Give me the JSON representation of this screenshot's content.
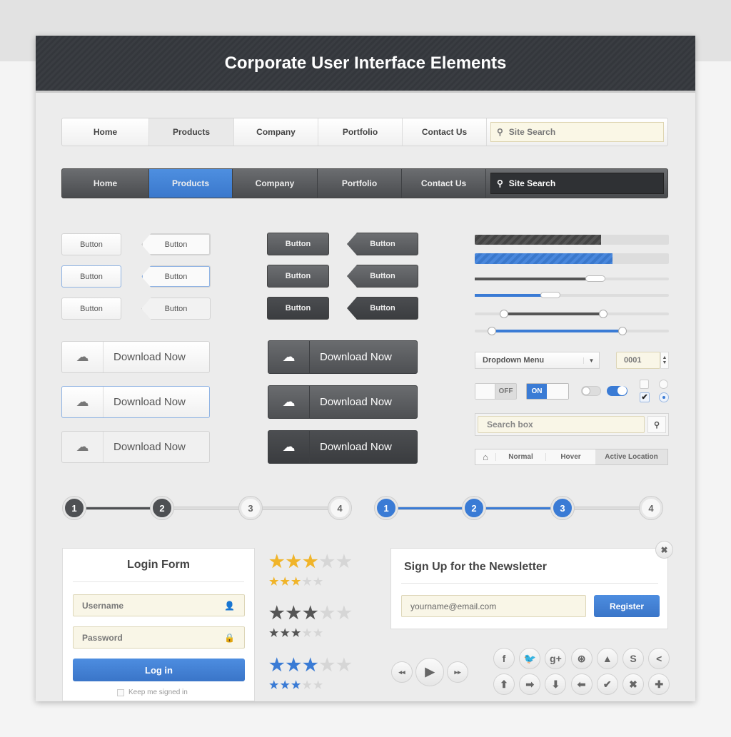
{
  "header": {
    "title": "Corporate User Interface Elements"
  },
  "nav_light": {
    "items": [
      "Home",
      "Products",
      "Company",
      "Portfolio",
      "Contact Us"
    ],
    "active": 1,
    "search_placeholder": "Site Search"
  },
  "nav_dark": {
    "items": [
      "Home",
      "Products",
      "Company",
      "Portfolio",
      "Contact Us"
    ],
    "active": 1,
    "search_placeholder": "Site Search"
  },
  "buttons": {
    "label": "Button"
  },
  "download": {
    "label": "Download Now",
    "icon": "cloud-download-icon"
  },
  "progress": {
    "bar1": 0.65,
    "bar2": 0.71
  },
  "sliders": {
    "s1": 0.62,
    "s2": 0.39,
    "range1": [
      0.15,
      0.66
    ],
    "range2": [
      0.09,
      0.76
    ]
  },
  "dropdown": {
    "value": "Dropdown Menu"
  },
  "number": {
    "value": "0001"
  },
  "toggles": {
    "off": "OFF",
    "on": "ON"
  },
  "search_box": {
    "value": "Search box"
  },
  "breadcrumb": {
    "items": [
      "Normal",
      "Hover",
      "Active Location"
    ]
  },
  "steppers": {
    "steps": [
      "1",
      "2",
      "3",
      "4"
    ],
    "dark_active": 2,
    "blue_active": 3
  },
  "login": {
    "title": "Login Form",
    "username": "Username",
    "password": "Password",
    "submit": "Log in",
    "remember": "Keep me signed in"
  },
  "ratings": [
    {
      "value": 3,
      "max": 5,
      "color": "#f0b429"
    },
    {
      "value": 3,
      "max": 5,
      "color": "#555555"
    },
    {
      "value": 3,
      "max": 5,
      "color": "#3a7bd5"
    }
  ],
  "newsletter": {
    "title": "Sign Up for the Newsletter",
    "email": "yourname@email.com",
    "submit": "Register"
  },
  "media": {
    "prev": "◂◂",
    "play": "▶",
    "next": "▸▸"
  },
  "icons_row1": [
    "facebook-icon",
    "twitter-icon",
    "google-plus-icon",
    "dribbble-icon",
    "forrst-icon",
    "skype-icon",
    "share-icon"
  ],
  "icons_row2": [
    "arrow-up-icon",
    "arrow-right-icon",
    "arrow-down-icon",
    "arrow-left-icon",
    "check-icon",
    "close-icon",
    "plus-icon"
  ],
  "colors": {
    "blue": "#3a7bd5",
    "dark": "#4e5053",
    "field": "#f9f6e7"
  }
}
